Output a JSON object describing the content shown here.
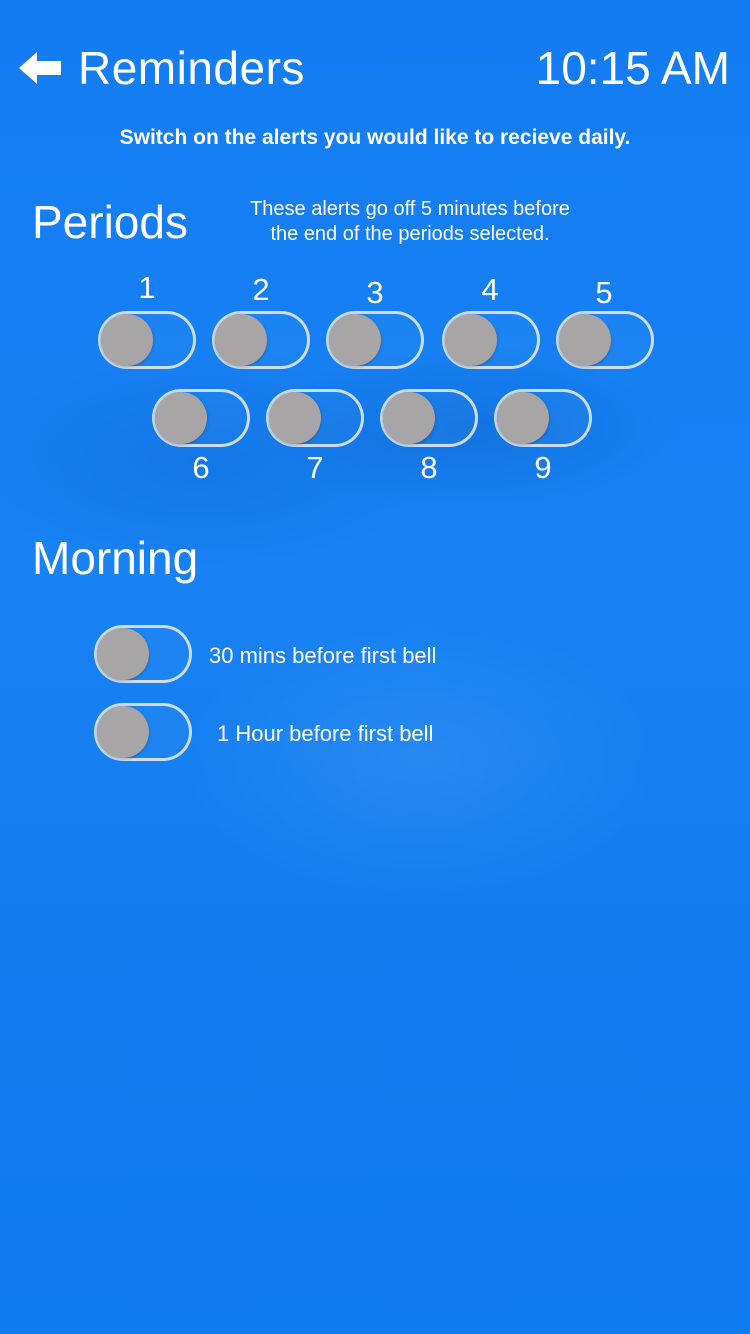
{
  "header": {
    "back_icon": "back-arrow-icon",
    "title": "Reminders",
    "time": "10:15 AM"
  },
  "instruction": "Switch on the alerts you would like to recieve daily.",
  "periods": {
    "heading": "Periods",
    "note_line1": "These alerts go off 5 minutes before",
    "note_line2": "the end of the periods selected.",
    "items": [
      {
        "label": "1",
        "on": false
      },
      {
        "label": "2",
        "on": false
      },
      {
        "label": "3",
        "on": false
      },
      {
        "label": "4",
        "on": false
      },
      {
        "label": "5",
        "on": false
      },
      {
        "label": "6",
        "on": false
      },
      {
        "label": "7",
        "on": false
      },
      {
        "label": "8",
        "on": false
      },
      {
        "label": "9",
        "on": false
      }
    ]
  },
  "morning": {
    "heading": "Morning",
    "items": [
      {
        "label": "30 mins before first bell",
        "on": false
      },
      {
        "label": "1 Hour before first bell",
        "on": false
      }
    ]
  },
  "colors": {
    "background": "#1480f2",
    "text": "#ffffff",
    "toggle_knob_off": "#a8a5a6",
    "toggle_border": "#e1e8f2"
  }
}
